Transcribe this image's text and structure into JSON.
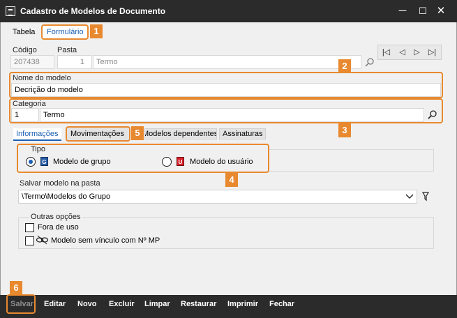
{
  "window": {
    "title": "Cadastro de Modelos de Documento",
    "minimize": "─",
    "maximize": "☐",
    "close": "✕"
  },
  "tabs": {
    "tabela": "Tabela",
    "formulario": "Formulário"
  },
  "badges": {
    "b1": "1",
    "b2": "2",
    "b3": "3",
    "b4": "4",
    "b5": "5",
    "b6": "6"
  },
  "codigo": {
    "label": "Código",
    "value": "207438"
  },
  "pasta": {
    "label": "Pasta",
    "number": "1",
    "name": "Termo"
  },
  "nav": {
    "first": "|◁",
    "prev": "◁",
    "next": "▷",
    "last": "▷|"
  },
  "nome_modelo": {
    "label": "Nome do modelo",
    "value": "Decrição do modelo"
  },
  "categoria": {
    "label": "Categoria",
    "code": "1",
    "name": "Termo"
  },
  "subtabs": {
    "informacoes": "Informações",
    "movimentacoes": "Movimentações",
    "modelos_dependentes": "Modelos dependentes",
    "assinaturas": "Assinaturas"
  },
  "tipo": {
    "label": "Tipo",
    "grupo_label": "Modelo de grupo",
    "grupo_icon": "G",
    "usuario_label": "Modelo do usuário",
    "usuario_icon": "U",
    "selected": "grupo"
  },
  "salvar_pasta": {
    "label": "Salvar modelo na pasta",
    "value": "\\Termo\\Modelos do Grupo"
  },
  "outras_opcoes": {
    "label": "Outras opções",
    "fora_de_uso": "Fora de uso",
    "sem_vinculo": "Modelo sem vínculo com Nº MP"
  },
  "toolbar": {
    "salvar": "Salvar",
    "editar": "Editar",
    "novo": "Novo",
    "excluir": "Excluir",
    "limpar": "Limpar",
    "restaurar": "Restaurar",
    "imprimir": "Imprimir",
    "fechar": "Fechar"
  },
  "colors": {
    "accent_orange": "#e8892f",
    "titlebar": "#2b2b2b",
    "radio_blue": "#1a5fb4",
    "icon_user_red": "#d8232a",
    "icon_group_blue": "#2a5fa8"
  }
}
